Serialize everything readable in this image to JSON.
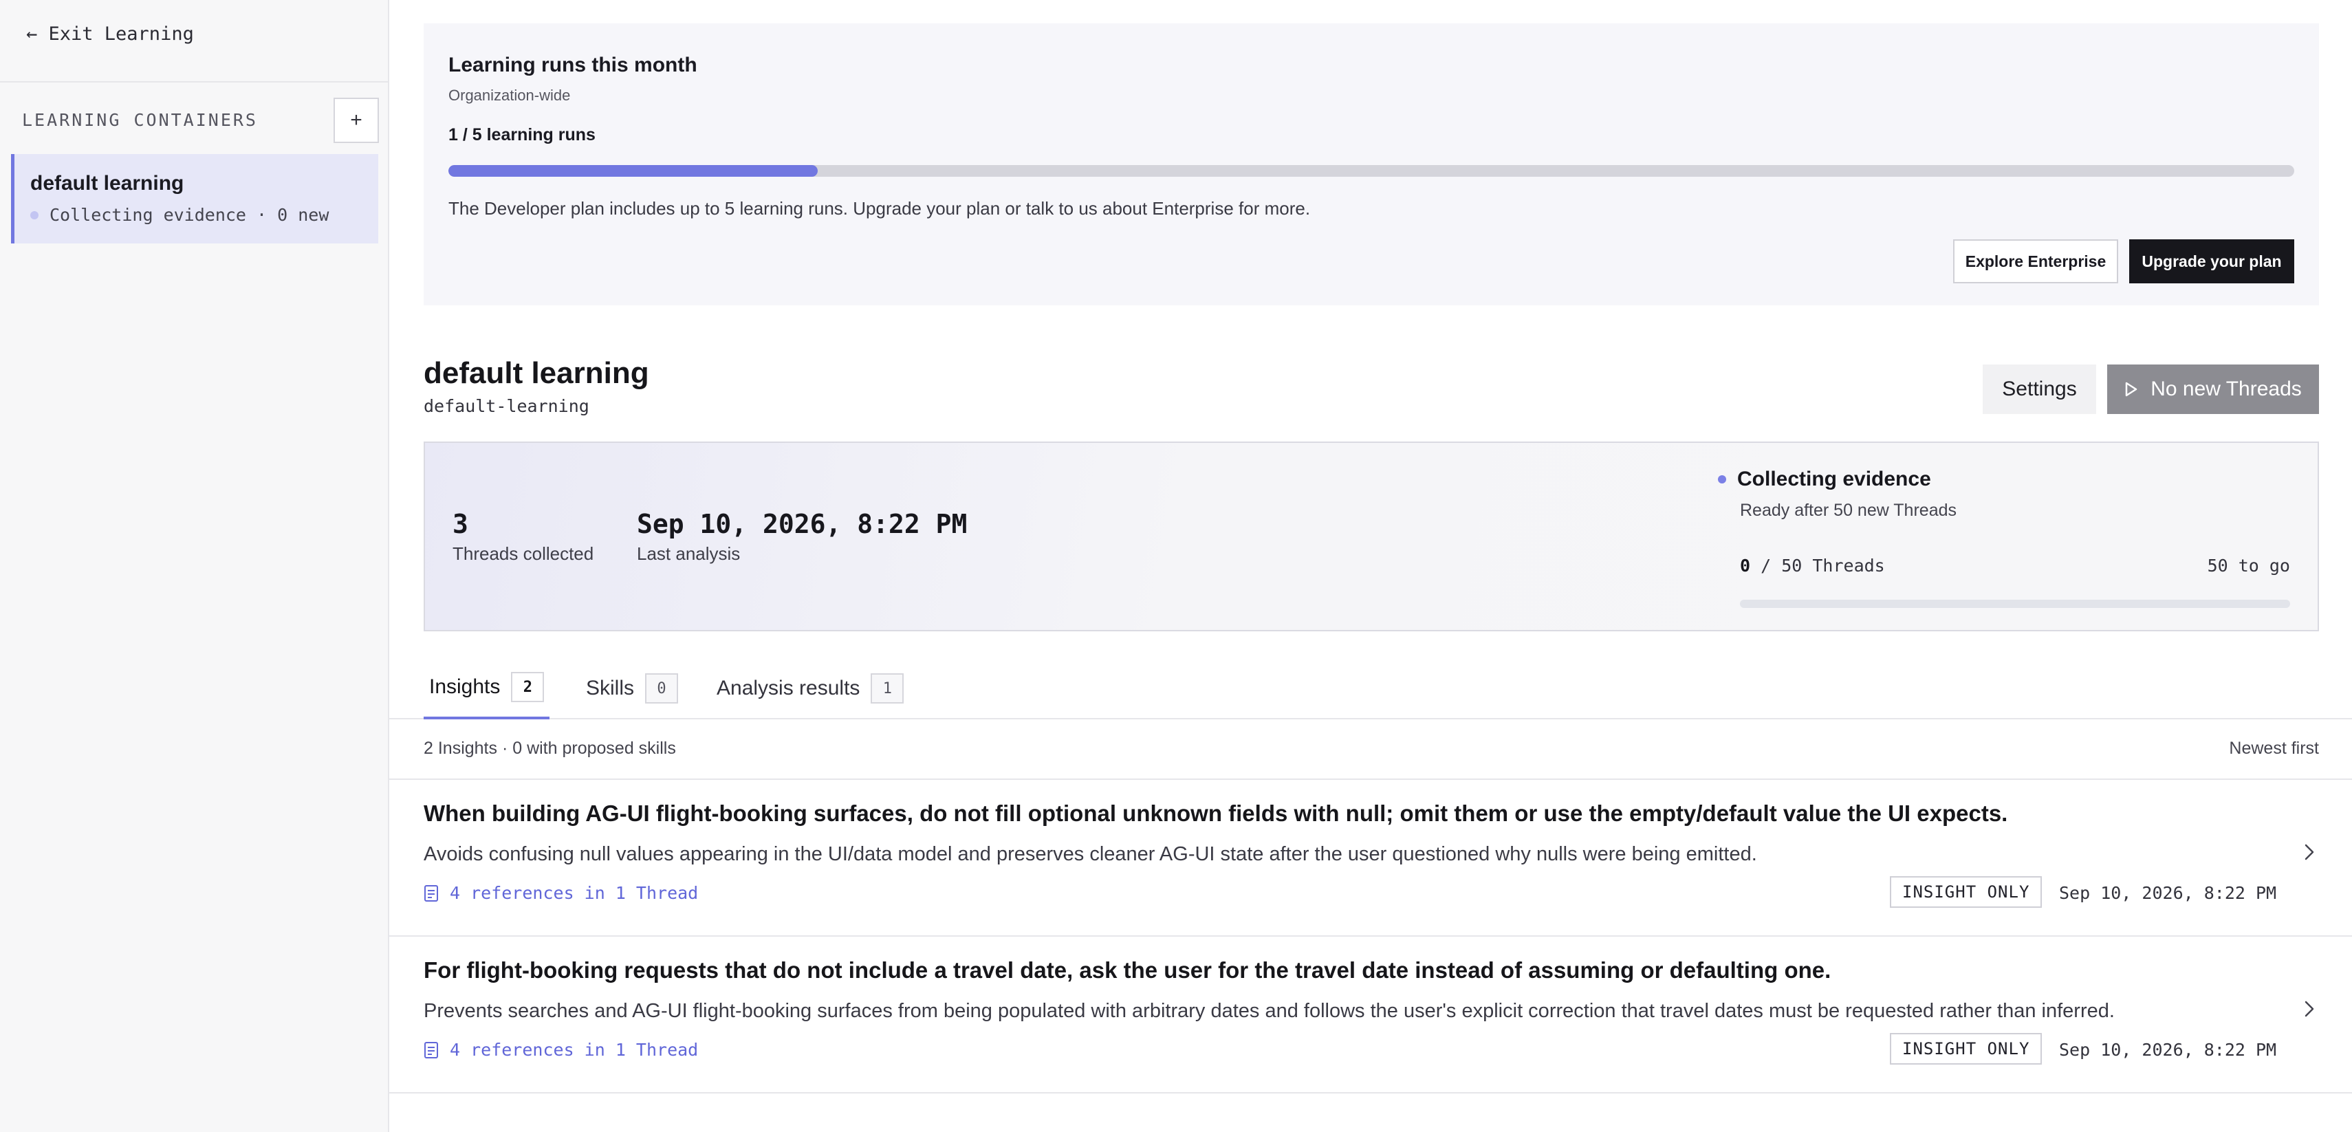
{
  "sidebar": {
    "exit_label": "← Exit Learning",
    "heading": "LEARNING CONTAINERS",
    "add_label": "+",
    "items": [
      {
        "title": "default learning",
        "status": "Collecting evidence · 0 new"
      }
    ]
  },
  "banner": {
    "title": "Learning runs this month",
    "subtitle": "Organization-wide",
    "count": "1 / 5 learning runs",
    "used": 1,
    "limit": 5,
    "description": "The Developer plan includes up to 5 learning runs. Upgrade your plan or talk to us about Enterprise for more.",
    "explore_label": "Explore Enterprise",
    "upgrade_label": "Upgrade your plan"
  },
  "container": {
    "title": "default learning",
    "slug": "default-learning",
    "settings_label": "Settings",
    "run_label": "No new Threads"
  },
  "stats": {
    "threads_value": "3",
    "threads_label": "Threads collected",
    "last_value": "Sep 10, 2026, 8:22 PM",
    "last_label": "Last analysis",
    "evidence_title": "Collecting evidence",
    "evidence_sub": "Ready after 50 new Threads",
    "evidence_current": "0",
    "evidence_total": " / 50 Threads",
    "evidence_togo": "50 to go",
    "evidence_fraction": 0
  },
  "tabs": [
    {
      "label": "Insights",
      "count": "2"
    },
    {
      "label": "Skills",
      "count": "0"
    },
    {
      "label": "Analysis results",
      "count": "1"
    }
  ],
  "list": {
    "meta": "2 Insights · 0 with proposed skills",
    "sort": "Newest first",
    "insights": [
      {
        "title": "When building AG-UI flight-booking surfaces, do not fill optional unknown fields with null; omit them or use the empty/default value the UI expects.",
        "description": "Avoids confusing null values appearing in the UI/data model and preserves cleaner AG-UI state after the user questioned why nulls were being emitted.",
        "refs": "4 references in 1 Thread",
        "badge": "INSIGHT ONLY",
        "date": "Sep 10, 2026, 8:22 PM"
      },
      {
        "title": "For flight-booking requests that do not include a travel date, ask the user for the travel date instead of assuming or defaulting one.",
        "description": "Prevents searches and AG-UI flight-booking surfaces from being populated with arbitrary dates and follows the user's explicit correction that travel dates must be requested rather than inferred.",
        "refs": "4 references in 1 Thread",
        "badge": "INSIGHT ONLY",
        "date": "Sep 10, 2026, 8:22 PM"
      }
    ]
  },
  "colors": {
    "accent": "#7177e0",
    "dark_button": "#17171c",
    "disabled_button": "#8c8c92"
  },
  "icons": {
    "add": "plus-icon",
    "run": "play-icon",
    "reference": "document-icon",
    "row_open": "chevron-right-icon",
    "status": "status-dot-icon"
  }
}
